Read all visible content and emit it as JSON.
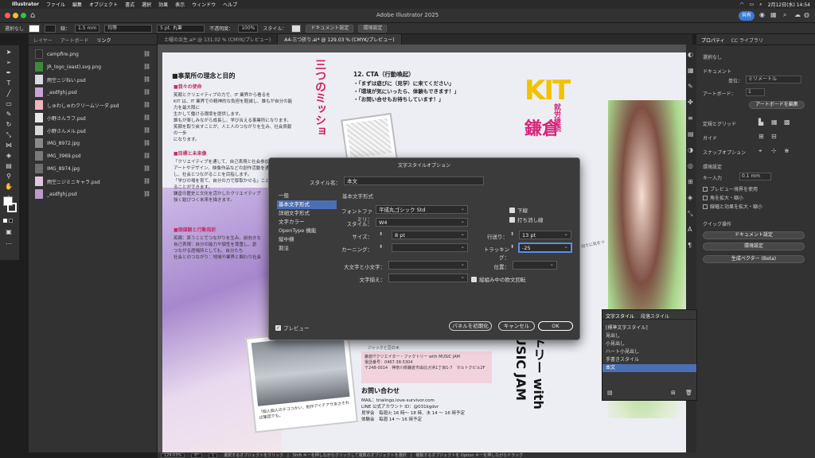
{
  "menubar": {
    "app": "Illustrator",
    "items": [
      "ファイル",
      "編集",
      "オブジェクト",
      "書式",
      "選択",
      "効果",
      "表示",
      "ウィンドウ",
      "ヘルプ"
    ],
    "datetime": "2月12日(水) 14:54"
  },
  "titlebar": {
    "title": "Adobe Illustrator 2025",
    "share": "共有"
  },
  "control": {
    "selection": "選択なし",
    "stroke_label": "線：",
    "stroke_value": "1.5 mm",
    "profile": "均等",
    "brush": "5 pt. 丸筆",
    "opacity_label": "不透明度：",
    "opacity_value": "100%",
    "style_label": "スタイル：",
    "doc_settings": "ドキュメント設定",
    "env_settings": "環境設定"
  },
  "links_panel": {
    "tabs": [
      "レイヤー",
      "アートボード",
      "リンク"
    ],
    "items": [
      "campfire.png",
      "JR_logo_(east).svg.png",
      "雨空ニジねい.psd",
      "_asdfghj.psd",
      "しゅわしゅわクリームソーダ.psd",
      "小野さんラフ.psd",
      "小野さんメル.psd",
      "IMG_8972.jpg",
      "IMG_3969.psd",
      "IMG_8974.jpg",
      "雨空ニジミニキャラ.psd",
      "_asdfghj.psd"
    ]
  },
  "doc_tabs": [
    "土曜の浜生.ai* @ 131.02 % (CMYK/プレビュー)",
    "A4-三つ折り.ai* @ 129.03 % (CMYK/プレビュー)"
  ],
  "artboard": {
    "heading1": "■事業所の理念と目的",
    "sub1": "■我々の使命",
    "p1": "笑顔とクリエイティブの力で、IT 業界から看るを",
    "p1b": "KIT は、IT 業界での精神的な負担を軽減し、誰もが自分の能力を最大限に",
    "p1c": "生かして働ける環境を提供します。",
    "p1d": "誰もが楽しみながら成長し、学び合える事業所になります。",
    "p1e": "笑顔を取り戻すことが、人と人のつながりを生み、社会貢献の一歩",
    "p1f": "になります。",
    "sub2": "■目標と未来像",
    "p2": "「クリエイティブを通して、自己表現と社会参加」",
    "p2b": "アートやデザイン、映像作品などの創作活動を通して、",
    "p2c": "し、社会とつながることを目指します。",
    "p2d": "「学びの場を育て、自分の力で厚取かせる」ことを",
    "p2e": "ることができます。",
    "p2f": "鎌倉の歴史と文化を活かしたクリエイティブ",
    "p2g": "強く結びつく未来を描きます。",
    "sub3": "■価値観と行動指針",
    "p3": "笑顔：笑うことでつながりを生み、前向きな",
    "p3b": "自己表現：自分の能力や個性を尊重し、創",
    "p3c": "つながる居場所としても、自分たち",
    "p3d": "社会とのつながり：地域や業界と関わり社会",
    "mission": "三つのミッショ",
    "cta_title": "12. CTA（行動喚起）",
    "cta1": "・「まずは遊びに（見学）に来てください」",
    "cta2": "・「環境が気にいったら、体験もできます！」",
    "cta3": "・「お問い合せもお待ちしています！」",
    "logo_big": "KIT",
    "kamakura": "鎌倉",
    "vertical_text": "就労継続",
    "factory_text": "クトリー with MUSIC JAM",
    "contact_title": "お問い合わせ",
    "mail": "MAIL：trialingo.love-survivor.com",
    "line": "LINE 公式アカウント ID：@031kgdvr",
    "visit1": "見学会　毎週火 16 時〜 18 時、水 14 〜 16 時予定",
    "visit2": "体験会　毎週 14 〜 16 時予定",
    "company": "鎌倉ITクリエイター・ファクトリー with MUSIC JAM",
    "tel": "電話番号：0467-38-5304",
    "addr": "〒248-0014　神奈川県鎌倉市由比ガ浜1丁目1-7　マルトクビル2F",
    "jack_caption": "ジャックと豆の木",
    "photo_caption": "「個人個人のテコつかい、制作アイテアサあさそれば集団でも。",
    "chibi_caption": "「ドカーン！切りに気をつけてね？」"
  },
  "dialog": {
    "title": "文字スタイルオプション",
    "style_name_label": "スタイル名：",
    "style_name_value": "本文",
    "categories": [
      "一般",
      "基本文字形式",
      "詳細文字形式",
      "文字カラー",
      "OpenType 機能",
      "縦中横",
      "割注"
    ],
    "section_title": "基本文字形式",
    "font_family_label": "フォントファミリ：",
    "font_family_value": "平成丸ゴシック Std",
    "font_style_label": "スタイル：",
    "font_style_value": "W4",
    "size_label": "サイズ：",
    "size_value": "8 pt",
    "leading_label": "行送り：",
    "leading_value": "13 pt",
    "kerning_label": "カーニング：",
    "kerning_value": "",
    "tracking_label": "トラッキング：",
    "tracking_value": "-25",
    "underline_label": "下線",
    "strike_label": "打ち消し線",
    "case_label": "大文字と小文字：",
    "position_label": "位置：",
    "align_label": "文字揃え：",
    "rotate_label": "縦組み中の欧文回転",
    "preview_label": "プレビュー",
    "reset_label": "パネルを初期化",
    "cancel_label": "キャンセル",
    "ok_label": "OK"
  },
  "char_style_panel": {
    "tabs": [
      "文字スタイル",
      "段落スタイル"
    ],
    "items": [
      "[標準文字スタイル]",
      "見出し",
      "小見出し",
      "ハート小見出し",
      "手書きスタイル",
      "本文"
    ]
  },
  "right_panel": {
    "tabs": [
      "プロパティ",
      "CC ライブラリ"
    ],
    "no_selection": "選択なし",
    "document": "ドキュメント",
    "unit_label": "単位：",
    "unit_value": "ミリメートル",
    "artboard_label": "アートボード：",
    "artboard_value": "1",
    "edit_artboard": "アートボードを編集",
    "ruler_grid": "定規とグリッド",
    "guides": "ガイド",
    "snap": "スナップオプション",
    "prefs": "環境設定",
    "key_input_label": "キー入力",
    "key_input_value": "0.1 mm",
    "preview_bounds": "プレビュー境界を使用",
    "scale_corners": "角を拡大・縮小",
    "scale_strokes": "線幅と効果を拡大・縮小",
    "quick_actions": "クイック操作",
    "doc_setup_btn": "ドキュメント設定",
    "prefs_btn": "環境設定",
    "vector_btn": "生成ベクター (Beta)"
  },
  "status": {
    "zoom": "129.03%",
    "angle": "0°",
    "page": "1",
    "hint": "選択するオブジェクトをクリック　|　Shift キーを押しながらクリックして複数のオブジェクトを選択　|　複製するオブジェクトを Option キーを押しながらドラッグ"
  },
  "colors": {
    "accent": "#4b6fb3",
    "artboard_bg": "#eceef4",
    "kit_yellow": "#f2c200",
    "kit_pink": "#d8247a",
    "kit_blue": "#1d6fc4",
    "kit_green": "#3aa845"
  }
}
